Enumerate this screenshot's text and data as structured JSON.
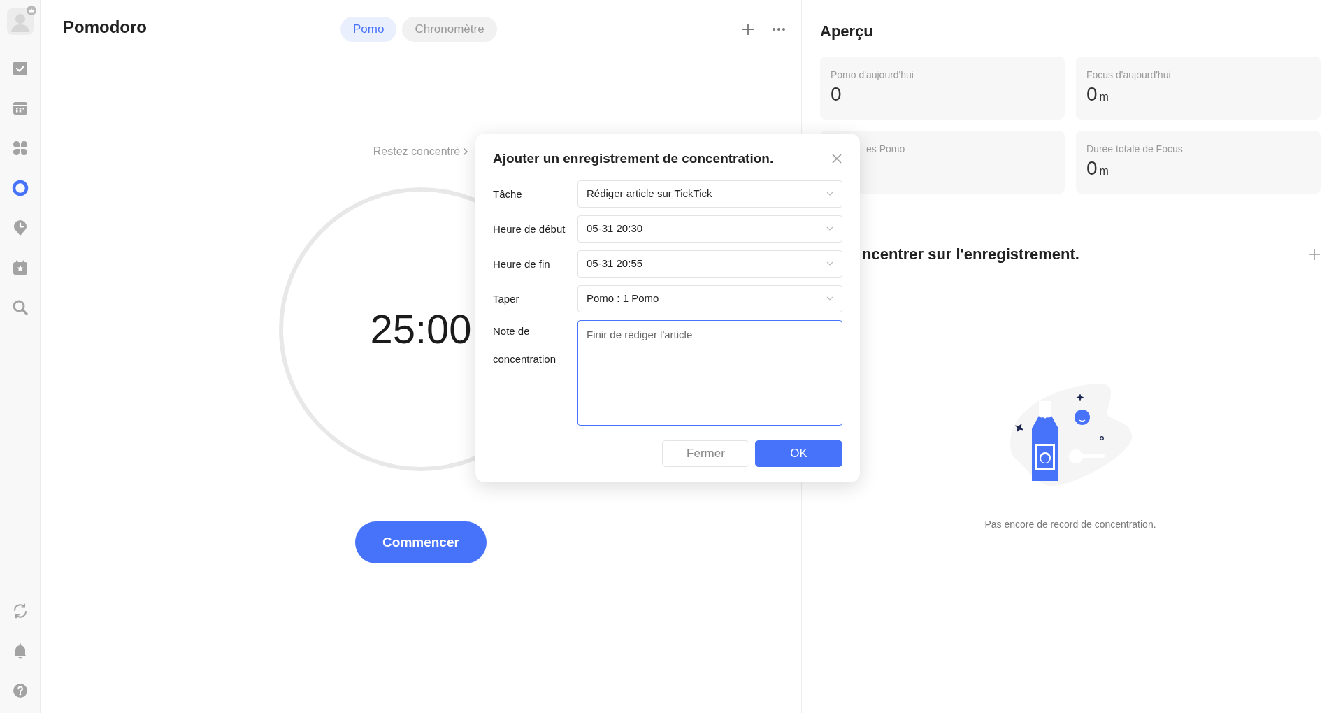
{
  "sidebar": {
    "top_items": [
      {
        "kind": "avatar",
        "selected": false
      },
      {
        "kind": "tasks",
        "selected": false
      },
      {
        "kind": "calendar",
        "selected": false
      },
      {
        "kind": "matrix",
        "selected": false
      },
      {
        "kind": "pomodoro",
        "selected": true
      },
      {
        "kind": "habit",
        "selected": false
      },
      {
        "kind": "countdown",
        "selected": false
      },
      {
        "kind": "search",
        "selected": false
      }
    ],
    "bottom_items": [
      {
        "kind": "sync"
      },
      {
        "kind": "notifications"
      },
      {
        "kind": "help"
      }
    ]
  },
  "header": {
    "title": "Pomodoro",
    "tabs": [
      {
        "label": "Pomo",
        "selected": true
      },
      {
        "label": "Chronomètre",
        "selected": false
      }
    ]
  },
  "timer": {
    "hint": "Restez concentré",
    "time": "25:00",
    "start_button": "Commencer"
  },
  "overview": {
    "title": "Aperçu",
    "stats": [
      {
        "label": "Pomo d'aujourd'hui",
        "value": "0"
      },
      {
        "label": "Focus d'aujourd'hui",
        "value": "0",
        "unit": "m"
      },
      {
        "label": "es Pomo"
      },
      {
        "label": "Durée totale de Focus",
        "value": "0",
        "unit": "m"
      }
    ]
  },
  "records": {
    "title": "ncentrer sur l'enregistrement.",
    "empty_text": "Pas encore de record de concentration."
  },
  "dialog": {
    "title": "Ajouter un enregistrement de concentration.",
    "fields": [
      {
        "kind": "select",
        "label": "Tâche",
        "value": "Rédiger article sur TickTick"
      },
      {
        "kind": "select",
        "label": "Heure de début",
        "value": "05-31 20:30"
      },
      {
        "kind": "select",
        "label": "Heure de fin",
        "value": "05-31 20:55"
      },
      {
        "kind": "select",
        "label": "Taper",
        "value": "Pomo : 1 Pomo"
      },
      {
        "kind": "textarea",
        "label": "Note de concentration",
        "value": "Finir de rédiger l'article"
      }
    ],
    "buttons": [
      {
        "label": "Fermer",
        "primary": false
      },
      {
        "label": "OK",
        "primary": true
      }
    ]
  }
}
